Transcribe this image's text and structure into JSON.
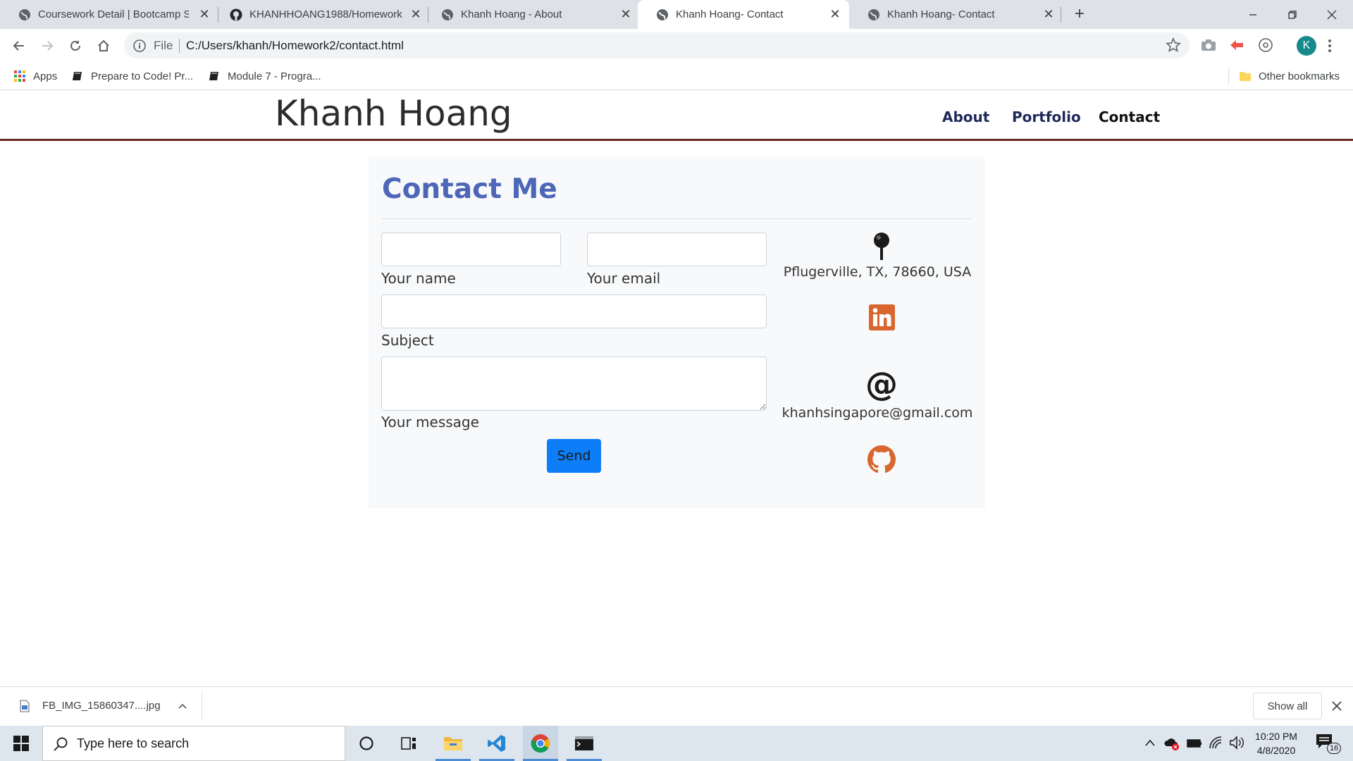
{
  "browser": {
    "tabs": [
      {
        "title": "Coursework Detail | Bootcamp Sp",
        "icon": "globe-icon",
        "active": false
      },
      {
        "title": "KHANHHOANG1988/Homework",
        "icon": "github-icon",
        "active": false
      },
      {
        "title": "Khanh Hoang - About",
        "icon": "globe-icon",
        "active": false
      },
      {
        "title": "Khanh Hoang- Contact",
        "icon": "globe-icon",
        "active": true
      },
      {
        "title": "Khanh Hoang- Contact",
        "icon": "globe-icon",
        "active": false
      }
    ],
    "address": {
      "scheme_label": "File",
      "url": "C:/Users/khanh/Homework2/contact.html"
    },
    "profile_initial": "K",
    "bookmarks": [
      {
        "label": "Apps",
        "icon": "apps-grid-icon"
      },
      {
        "label": "Prepare to Code! Pr...",
        "icon": "book-icon"
      },
      {
        "label": "Module 7 - Progra...",
        "icon": "book-icon"
      }
    ],
    "other_bookmarks": "Other bookmarks"
  },
  "site": {
    "brand": "Khanh Hoang",
    "nav": [
      {
        "label": "About",
        "current": false
      },
      {
        "label": "Portfolio",
        "current": false
      },
      {
        "label": "Contact",
        "current": true
      }
    ]
  },
  "contact": {
    "heading": "Contact Me",
    "fields": {
      "name_label": "Your name",
      "email_label": "Your email",
      "subject_label": "Subject",
      "message_label": "Your message",
      "name_value": "",
      "email_value": "",
      "subject_value": "",
      "message_value": ""
    },
    "send_label": "Send",
    "location": "Pflugerville, TX, 78660, USA",
    "email": "khanhsingapore@gmail.com"
  },
  "downloads": {
    "file": "FB_IMG_15860347....jpg",
    "show_all": "Show all"
  },
  "taskbar": {
    "search_placeholder": "Type here to search",
    "time": "10:20 PM",
    "date": "4/8/2020",
    "notifications": "16"
  },
  "colors": {
    "heading": "#4d66b8",
    "header_border": "#6b2b20",
    "social_icons": "#d9662f",
    "send_button": "#0d7ef8"
  }
}
